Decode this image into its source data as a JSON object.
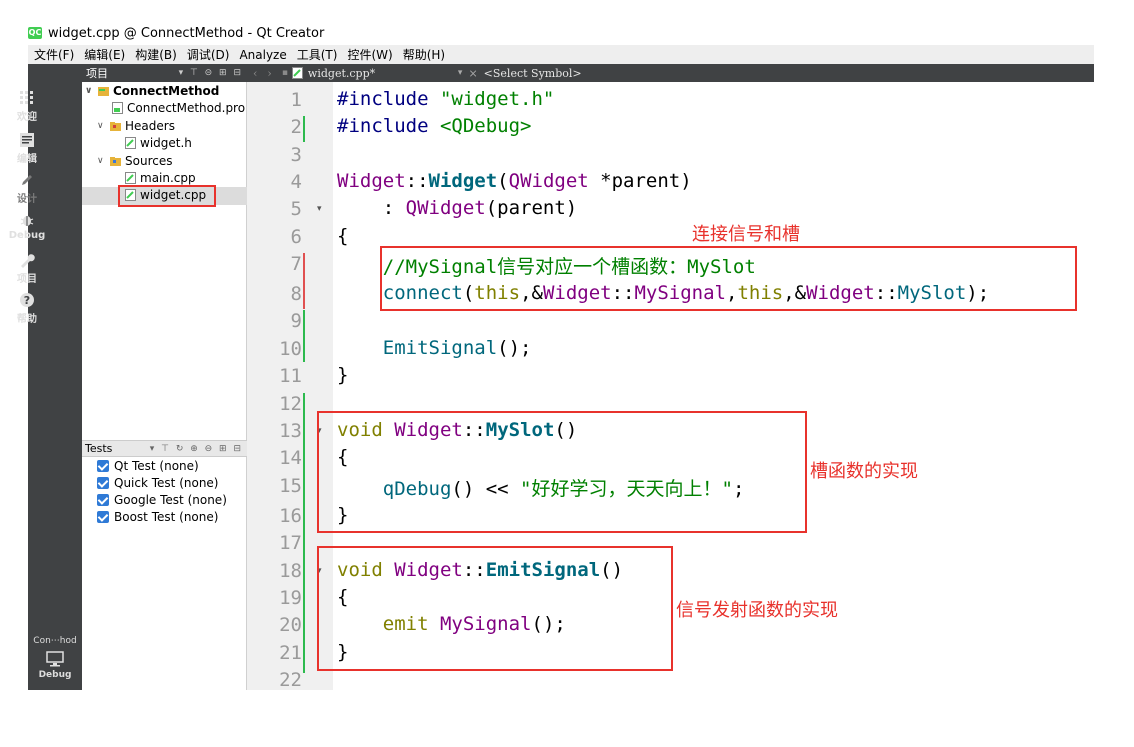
{
  "window": {
    "title": "widget.cpp @ ConnectMethod - Qt Creator",
    "logo": "QC"
  },
  "menu": [
    "文件(F)",
    "编辑(E)",
    "构建(B)",
    "调试(D)",
    "Analyze",
    "工具(T)",
    "控件(W)",
    "帮助(H)"
  ],
  "modes": [
    {
      "label": "欢迎",
      "icon": "grid-icon",
      "enabled": true
    },
    {
      "label": "编辑",
      "icon": "edit-icon",
      "enabled": true
    },
    {
      "label": "设计",
      "icon": "pen-icon",
      "enabled": false
    },
    {
      "label": "Debug",
      "icon": "bug-icon",
      "enabled": true
    },
    {
      "label": "项目",
      "icon": "wrench-icon",
      "enabled": true
    },
    {
      "label": "帮助",
      "icon": "help-icon",
      "enabled": true
    }
  ],
  "mode_bottom": {
    "project": "Con⋯hod",
    "debug": "Debug",
    "icon": "monitor-icon"
  },
  "project_pane": {
    "title": "项目",
    "tree": [
      {
        "label": "ConnectMethod",
        "level": 0,
        "bold": true,
        "arrow": "v",
        "icon": "project-icon"
      },
      {
        "label": "ConnectMethod.pro",
        "level": 1,
        "arrow": "",
        "icon": "pro-file-icon"
      },
      {
        "label": "Headers",
        "level": 1,
        "arrow": "v",
        "icon": "folder-icon"
      },
      {
        "label": "widget.h",
        "level": 2,
        "arrow": "",
        "icon": "header-file-icon"
      },
      {
        "label": "Sources",
        "level": 1,
        "arrow": "v",
        "icon": "folder-icon"
      },
      {
        "label": "main.cpp",
        "level": 2,
        "arrow": "",
        "icon": "cpp-file-icon"
      },
      {
        "label": "widget.cpp",
        "level": 2,
        "arrow": "",
        "icon": "cpp-file-icon",
        "selected": true
      }
    ]
  },
  "tests_pane": {
    "title": "Tests",
    "items": [
      "Qt Test (none)",
      "Quick Test (none)",
      "Google Test (none)",
      "Boost Test (none)"
    ]
  },
  "editor": {
    "file_tab": "widget.cpp*",
    "symbol": "<Select Symbol>",
    "line_numbers": [
      "1",
      "2",
      "3",
      "4",
      "5",
      "6",
      "7",
      "8",
      "9",
      "10",
      "11",
      "12",
      "13",
      "14",
      "15",
      "16",
      "17",
      "18",
      "19",
      "20",
      "21",
      "22"
    ]
  },
  "annotations": {
    "connect": "连接信号和槽",
    "slot_impl": "槽函数的实现",
    "emit_impl": "信号发射函数的实现"
  },
  "colors": {
    "annotation": "#e8322c",
    "keyword": "#808000",
    "class": "#800080",
    "function": "#00677c",
    "string": "#008000",
    "dark_panel": "#404244"
  }
}
